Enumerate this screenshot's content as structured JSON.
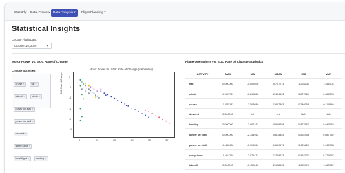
{
  "nav": {
    "items": [
      {
        "label": "StackFly",
        "active": false
      },
      {
        "label": "Data Preview",
        "active": false
      },
      {
        "label": "Data Analysis ▾",
        "active": true
      },
      {
        "label": "Flight Planning ▾",
        "active": false
      }
    ]
  },
  "page": {
    "title": "Statistical Insights",
    "date_label": "Choose Flight Date:",
    "date_value": "October 18, 2020"
  },
  "left_section": {
    "title": "Motor Power vs. SOC Rate of Change",
    "activities_label": "Choose activities:",
    "activities": [
      "cruise",
      "flat",
      "takeoff",
      "climb",
      "power off stall",
      "power on stall",
      "descent",
      "steep turns",
      "level flight",
      "landing"
    ]
  },
  "chart": {
    "title": "Motor Power vs. SOC Rate of Change (calculated)",
    "ylabel": "SOC Rate of Change",
    "xticks": [
      "0",
      "10",
      "20",
      "30",
      "40",
      "50"
    ],
    "yticks": [
      "0",
      "-2",
      "-4",
      "-6",
      "-8",
      "-10"
    ]
  },
  "chart_data": {
    "type": "scatter",
    "title": "Motor Power vs. SOC Rate of Change (calculated)",
    "xlabel": "",
    "ylabel": "SOC Rate of Change",
    "xlim": [
      -2,
      53
    ],
    "ylim": [
      -11,
      0.5
    ],
    "series": [
      {
        "name": "climb",
        "color": "#2b3fb8",
        "points": [
          [
            12,
            -2.6
          ],
          [
            14,
            -3.0
          ],
          [
            16,
            -3.3
          ],
          [
            18,
            -3.7
          ],
          [
            20,
            -4.0
          ],
          [
            22,
            -4.4
          ],
          [
            24,
            -4.8
          ],
          [
            26,
            -5.1
          ],
          [
            28,
            -5.5
          ],
          [
            30,
            -5.9
          ],
          [
            32,
            -6.2
          ],
          [
            34,
            -6.6
          ],
          [
            36,
            -7.0
          ],
          [
            38,
            -7.3
          ],
          [
            40,
            -7.7
          ],
          [
            15,
            -3.4
          ],
          [
            21,
            -4.1
          ],
          [
            27,
            -5.4
          ]
        ]
      },
      {
        "name": "cruise",
        "color": "#6a7f96",
        "points": [
          [
            0,
            -0.5
          ],
          [
            1,
            -1.0
          ],
          [
            2,
            -1.4
          ],
          [
            3,
            -1.6
          ],
          [
            4,
            -2.0
          ],
          [
            5,
            -2.2
          ],
          [
            6,
            -2.5
          ],
          [
            7,
            -2.8
          ],
          [
            8,
            -3.0
          ],
          [
            9,
            -3.4
          ],
          [
            10,
            -3.6
          ],
          [
            11,
            -3.9
          ],
          [
            1,
            -2.2
          ],
          [
            3,
            -2.6
          ],
          [
            5,
            -3.0
          ]
        ]
      },
      {
        "name": "takeoff",
        "color": "#e05050",
        "points": [
          [
            38,
            -6.3
          ],
          [
            40,
            -6.6
          ],
          [
            42,
            -7.0
          ],
          [
            44,
            -7.4
          ],
          [
            46,
            -7.7
          ],
          [
            48,
            -8.1
          ],
          [
            50,
            -8.4
          ],
          [
            52,
            -8.8
          ]
        ]
      },
      {
        "name": "landing",
        "color": "#2aa06a",
        "points": [
          [
            0,
            -0.4
          ],
          [
            1,
            -0.7
          ],
          [
            2,
            -1.1
          ],
          [
            0,
            -1.6
          ],
          [
            1,
            -3.3
          ],
          [
            2,
            -4.1
          ],
          [
            0,
            -6.0
          ],
          [
            1,
            -7.6
          ],
          [
            0,
            -8.3
          ]
        ]
      },
      {
        "name": "descent",
        "color": "#e6b800",
        "points": [
          [
            3,
            -1.2
          ],
          [
            5,
            -1.6
          ],
          [
            7,
            -2.0
          ],
          [
            9,
            -3.8
          ]
        ]
      },
      {
        "name": "steep turns",
        "color": "#c070e0",
        "points": [
          [
            6,
            -1.8
          ],
          [
            8,
            -2.2
          ],
          [
            10,
            -2.6
          ],
          [
            12,
            -2.2
          ]
        ]
      }
    ]
  },
  "right_section": {
    "title": "Plane Operations vs. SOC Rate of Change Statistics"
  },
  "table": {
    "headers": [
      "ACTIVITY",
      "MAX",
      "MIN",
      "MEAN",
      "STD",
      "VAR"
    ],
    "rows": [
      [
        "flat",
        "0.000000",
        "-5.000000",
        "-0.757273",
        "1.228230",
        "1.511904"
      ],
      [
        "climb",
        "-1.107761",
        "-3.819288",
        "-2.454193",
        "0.827864",
        "0.685393"
      ],
      [
        "cruise",
        "-1.075183",
        "-2.503686",
        "-1.897863",
        "0.340358",
        "0.115849"
      ],
      [
        "descent",
        "0.000000",
        "inf",
        "-inf",
        "NaN",
        "NaN"
      ],
      [
        "landing",
        "0.000000",
        "-2.807143",
        "-0.898788",
        "0.877867",
        "0.647663"
      ],
      [
        "power off stall",
        "0.000000",
        "-2.743952",
        "-0.875853",
        "0.828748",
        "0.687752"
      ],
      [
        "power on stall",
        "-1.458128",
        "-1.710384",
        "-1.609071",
        "0.125424",
        "0.015733"
      ],
      [
        "steep turns",
        "-0.414718",
        "-2.076471",
        "-1.258623",
        "0.852770",
        "0.726957"
      ],
      [
        "takeoff",
        "0.000000",
        "-3.452843",
        "-2.158695",
        "1.285974",
        "1.663722"
      ]
    ]
  }
}
